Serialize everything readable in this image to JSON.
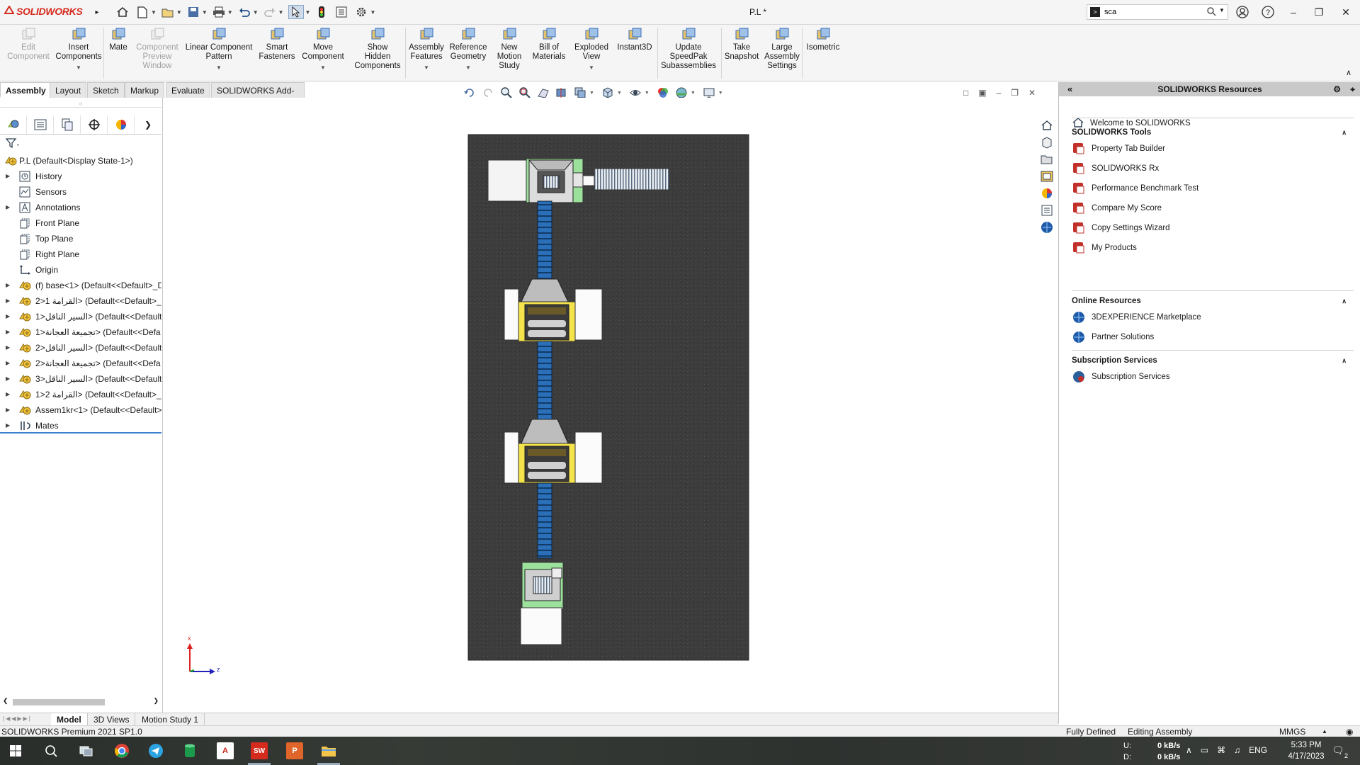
{
  "app": {
    "brand": "SOLIDWORKS",
    "brand_color": "#d52b1e",
    "doc_title": "P.L *"
  },
  "search": {
    "value": "sca"
  },
  "commands": [
    {
      "label": "Edit\nComponent",
      "enabled": false
    },
    {
      "label": "Insert\nComponents",
      "enabled": true
    },
    {
      "label": "Mate",
      "enabled": true
    },
    {
      "label": "Component\nPreview\nWindow",
      "enabled": false
    },
    {
      "label": "Linear Component\nPattern",
      "enabled": true
    },
    {
      "label": "Smart\nFasteners",
      "enabled": true
    },
    {
      "label": "Move\nComponent",
      "enabled": true
    },
    {
      "label": "Show\nHidden\nComponents",
      "enabled": true
    },
    {
      "label": "Assembly\nFeatures",
      "enabled": true
    },
    {
      "label": "Reference\nGeometry",
      "enabled": true
    },
    {
      "label": "New\nMotion\nStudy",
      "enabled": true
    },
    {
      "label": "Bill of\nMaterials",
      "enabled": true
    },
    {
      "label": "Exploded\nView",
      "enabled": true
    },
    {
      "label": "Instant3D",
      "enabled": true
    },
    {
      "label": "Update\nSpeedPak\nSubassemblies",
      "enabled": true
    },
    {
      "label": "Take\nSnapshot",
      "enabled": true
    },
    {
      "label": "Large\nAssembly\nSettings",
      "enabled": true
    },
    {
      "label": "Isometric",
      "enabled": true
    }
  ],
  "tabs": [
    "Assembly",
    "Layout",
    "Sketch",
    "Markup",
    "Evaluate",
    "SOLIDWORKS Add-Ins"
  ],
  "tree": {
    "root": "P.L  (Default<Display State-1>)",
    "nodes": [
      {
        "label": "History",
        "icon": "history-icon",
        "expandable": true
      },
      {
        "label": "Sensors",
        "icon": "sensors-icon",
        "expandable": false
      },
      {
        "label": "Annotations",
        "icon": "annotations-icon",
        "expandable": true
      },
      {
        "label": "Front Plane",
        "icon": "plane-icon",
        "expandable": false
      },
      {
        "label": "Top Plane",
        "icon": "plane-icon",
        "expandable": false
      },
      {
        "label": "Right Plane",
        "icon": "plane-icon",
        "expandable": false
      },
      {
        "label": "Origin",
        "icon": "origin-icon",
        "expandable": false
      },
      {
        "label": "(f) base<1> (Default<<Default>_D",
        "icon": "subassembly-icon",
        "expandable": true
      },
      {
        "label": "القرامة 1<2> (Default<<Default>_",
        "icon": "subassembly-icon",
        "expandable": true
      },
      {
        "label": "السير الناقل<1> (Default<<Default",
        "icon": "subassembly-icon",
        "expandable": true
      },
      {
        "label": "تجميعة العجانة<1> (Default<<Defa",
        "icon": "subassembly-icon",
        "expandable": true
      },
      {
        "label": "السير الناقل<2> (Default<<Default",
        "icon": "subassembly-icon",
        "expandable": true
      },
      {
        "label": "تجميعة العجانة<2> (Default<<Defa",
        "icon": "subassembly-icon",
        "expandable": true
      },
      {
        "label": "السير الناقل<3> (Default<<Default",
        "icon": "subassembly-icon",
        "expandable": true
      },
      {
        "label": "القرامة 2<1> (Default<<Default>_",
        "icon": "subassembly-icon",
        "expandable": true
      },
      {
        "label": "Assem1kr<1> (Default<<Default>",
        "icon": "subassembly-icon",
        "expandable": true
      },
      {
        "label": "Mates",
        "icon": "mates-icon",
        "expandable": true
      }
    ]
  },
  "triad": {
    "x": "x",
    "z": "z"
  },
  "taskpane": {
    "title": "SOLIDWORKS Resources",
    "welcome": "Welcome to SOLIDWORKS",
    "sections": [
      {
        "title": "SOLIDWORKS Tools",
        "items": [
          "Property Tab Builder",
          "SOLIDWORKS Rx",
          "Performance Benchmark Test",
          "Compare My Score",
          "Copy Settings Wizard",
          "My Products"
        ]
      },
      {
        "title": "Online Resources",
        "items": [
          "3DEXPERIENCE Marketplace",
          "Partner Solutions"
        ]
      },
      {
        "title": "Subscription Services",
        "items": [
          "Subscription Services"
        ]
      }
    ]
  },
  "bottom_tabs": [
    "Model",
    "3D Views",
    "Motion Study 1"
  ],
  "status": {
    "product": "SOLIDWORKS Premium 2021 SP1.0",
    "state": "Fully Defined",
    "mode": "Editing Assembly",
    "units": "MMGS"
  },
  "taskbar": {
    "net_up_label": "U:",
    "net_up": "0 kB/s",
    "net_down_label": "D:",
    "net_down": "0 kB/s",
    "lang": "ENG",
    "time": "5:33 PM",
    "date": "4/17/2023",
    "notif_count": "2"
  }
}
